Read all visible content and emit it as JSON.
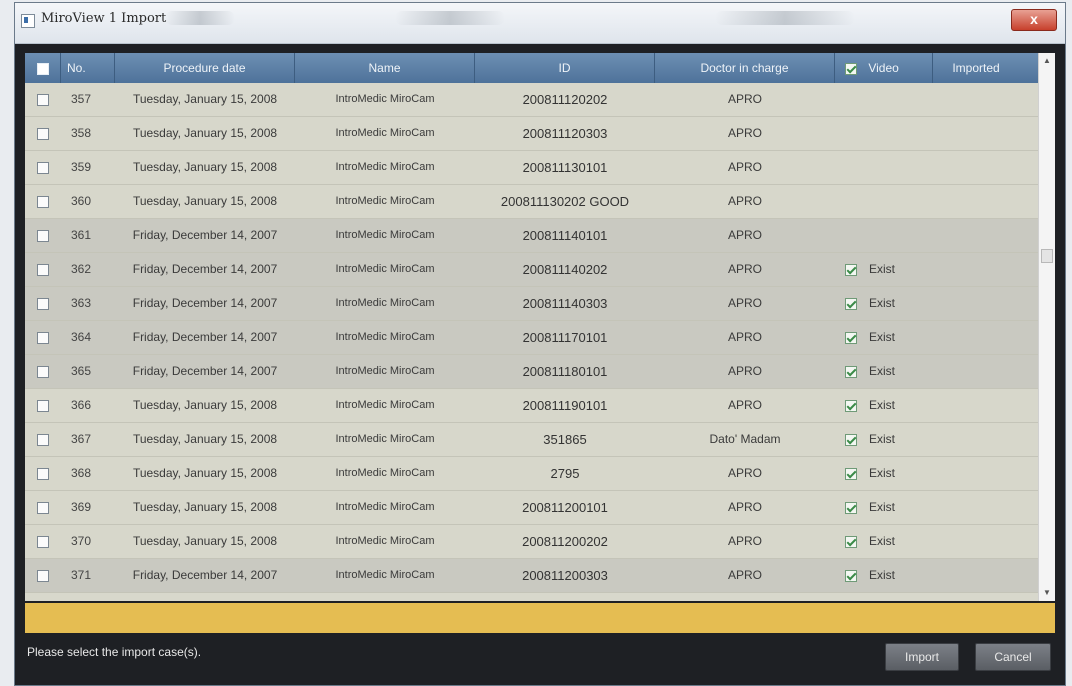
{
  "window": {
    "title": "MiroView 1 Import",
    "close_label": "x"
  },
  "grid": {
    "columns": {
      "no": "No.",
      "procedure_date": "Procedure date",
      "name": "Name",
      "id": "ID",
      "doctor": "Doctor in charge",
      "video": "Video",
      "imported": "Imported"
    },
    "rows": [
      {
        "no": "357",
        "date": "Tuesday, January 15, 2008",
        "name": "IntroMedic MiroCam",
        "id": "200811120202",
        "doctor": "APRO",
        "video": ""
      },
      {
        "no": "358",
        "date": "Tuesday, January 15, 2008",
        "name": "IntroMedic MiroCam",
        "id": "200811120303",
        "doctor": "APRO",
        "video": ""
      },
      {
        "no": "359",
        "date": "Tuesday, January 15, 2008",
        "name": "IntroMedic MiroCam",
        "id": "200811130101",
        "doctor": "APRO",
        "video": ""
      },
      {
        "no": "360",
        "date": "Tuesday, January 15, 2008",
        "name": "IntroMedic MiroCam",
        "id": "200811130202 GOOD",
        "doctor": "APRO",
        "video": ""
      },
      {
        "no": "361",
        "date": "Friday, December 14, 2007",
        "name": "IntroMedic MiroCam",
        "id": "200811140101",
        "doctor": "APRO",
        "video": ""
      },
      {
        "no": "362",
        "date": "Friday, December 14, 2007",
        "name": "IntroMedic MiroCam",
        "id": "200811140202",
        "doctor": "APRO",
        "video": "Exist"
      },
      {
        "no": "363",
        "date": "Friday, December 14, 2007",
        "name": "IntroMedic MiroCam",
        "id": "200811140303",
        "doctor": "APRO",
        "video": "Exist"
      },
      {
        "no": "364",
        "date": "Friday, December 14, 2007",
        "name": "IntroMedic MiroCam",
        "id": "200811170101",
        "doctor": "APRO",
        "video": "Exist"
      },
      {
        "no": "365",
        "date": "Friday, December 14, 2007",
        "name": "IntroMedic MiroCam",
        "id": "200811180101",
        "doctor": "APRO",
        "video": "Exist"
      },
      {
        "no": "366",
        "date": "Tuesday, January 15, 2008",
        "name": "IntroMedic MiroCam",
        "id": "200811190101",
        "doctor": "APRO",
        "video": "Exist"
      },
      {
        "no": "367",
        "date": "Tuesday, January 15, 2008",
        "name": "IntroMedic MiroCam",
        "id": "351865",
        "doctor": "Dato' Madam",
        "video": "Exist"
      },
      {
        "no": "368",
        "date": "Tuesday, January 15, 2008",
        "name": "IntroMedic MiroCam",
        "id": "2795",
        "doctor": "APRO",
        "video": "Exist"
      },
      {
        "no": "369",
        "date": "Tuesday, January 15, 2008",
        "name": "IntroMedic MiroCam",
        "id": "200811200101",
        "doctor": "APRO",
        "video": "Exist"
      },
      {
        "no": "370",
        "date": "Tuesday, January 15, 2008",
        "name": "IntroMedic MiroCam",
        "id": "200811200202",
        "doctor": "APRO",
        "video": "Exist"
      },
      {
        "no": "371",
        "date": "Friday, December 14, 2007",
        "name": "IntroMedic MiroCam",
        "id": "200811200303",
        "doctor": "APRO",
        "video": "Exist"
      }
    ]
  },
  "footer": {
    "status_text": "Please select the import case(s).",
    "import_label": "Import",
    "cancel_label": "Cancel"
  },
  "colors": {
    "header_blue": "#5a7ea5",
    "status_yellow": "#e5bd52",
    "window_dark": "#1e2024"
  }
}
